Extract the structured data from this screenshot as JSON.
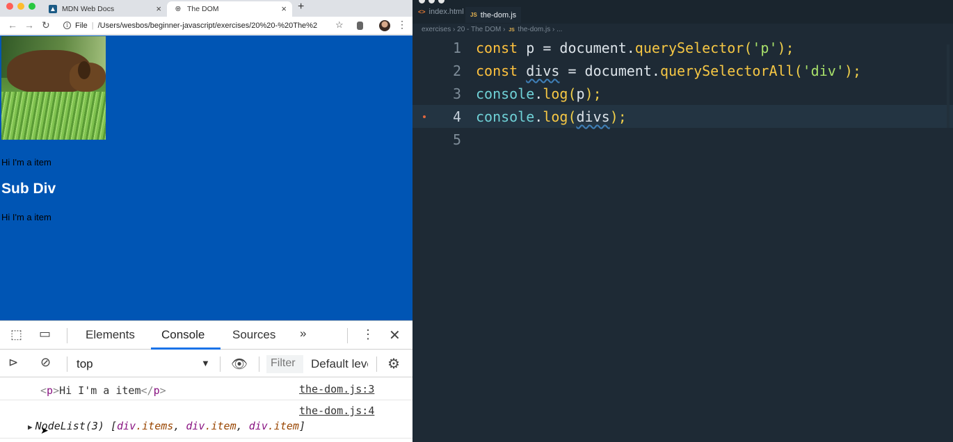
{
  "browser": {
    "tabs": [
      {
        "title": "MDN Web Docs",
        "icon": "mdn-icon"
      },
      {
        "title": "The DOM",
        "icon": "globe-icon"
      }
    ],
    "url_scheme": "File",
    "url": "/Users/wesbos/beginner-javascript/exercises/20%20-%20The%2",
    "page": {
      "items": [
        "Hi I'm a item",
        "Hi I'm a item"
      ],
      "heading": "Sub Div",
      "background": "#0055b4"
    },
    "devtools": {
      "tabs": [
        "Elements",
        "Console",
        "Sources"
      ],
      "active_tab": "Console",
      "more_tabs": "»",
      "context": "top",
      "filter_placeholder": "Filter",
      "levels": "Default levels",
      "console": [
        {
          "source": "the-dom.js:3",
          "open": "<",
          "tag": "p",
          "close": ">",
          "text": "Hi I'm a item",
          "end_open": "</",
          "end_tag": "p",
          "end_close": ">"
        },
        {
          "source": "the-dom.js:4",
          "prefix": "NodeList(3) [",
          "items": [
            {
              "el": "div",
              "cls": ".items"
            },
            {
              "el": "div",
              "cls": ".item"
            },
            {
              "el": "div",
              "cls": ".item"
            }
          ],
          "suffix": "]"
        }
      ]
    }
  },
  "editor": {
    "tabs": [
      {
        "label": "index.html",
        "icon": "<>"
      },
      {
        "label": "the-dom.js",
        "icon": "JS"
      }
    ],
    "breadcrumb": [
      "exercises",
      "20 - The DOM",
      "the-dom.js",
      "..."
    ],
    "lines": [
      {
        "num": "1",
        "tokens": [
          "const",
          " p = document.",
          "querySelector",
          "(",
          "'p'",
          ");"
        ]
      },
      {
        "num": "2",
        "tokens": [
          "const",
          " ",
          "divs",
          " = document.",
          "querySelectorAll",
          "(",
          "'div'",
          ");"
        ]
      },
      {
        "num": "3",
        "tokens": [
          "console",
          ".",
          "log",
          "(",
          "p",
          ");"
        ]
      },
      {
        "num": "4",
        "tokens": [
          "console",
          ".",
          "log",
          "(",
          "divs",
          ");"
        ]
      },
      {
        "num": "5",
        "tokens": []
      }
    ]
  }
}
